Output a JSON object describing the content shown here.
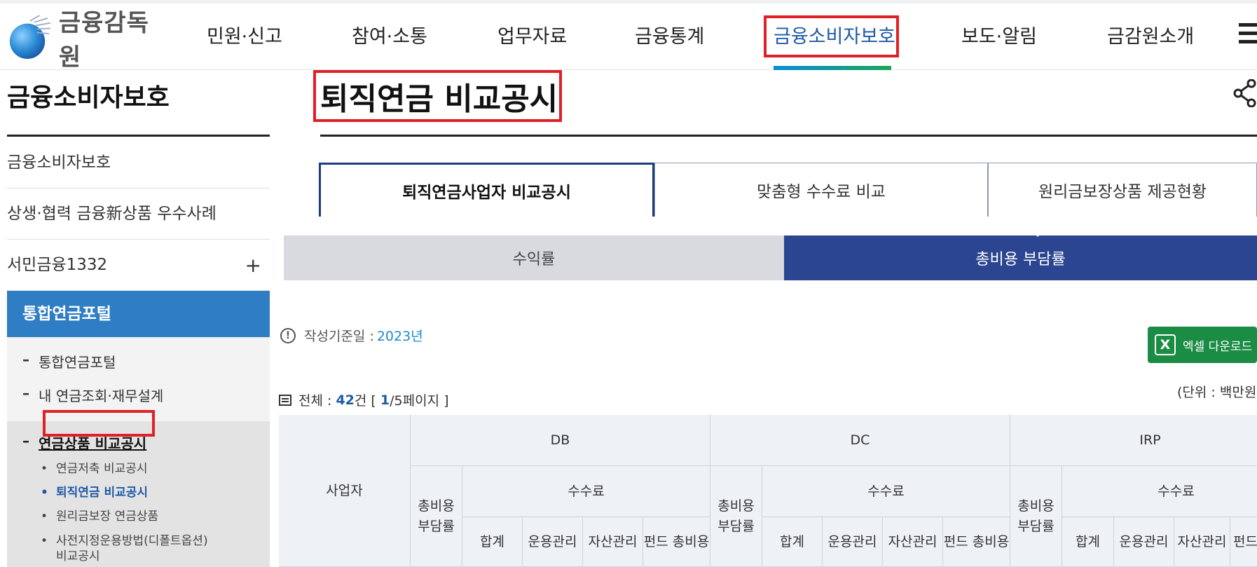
{
  "header": {
    "logo_text": "금융감독원",
    "nav": [
      "민원·신고",
      "참여·소통",
      "업무자료",
      "금융통계",
      "금융소비자보호",
      "보도·알림",
      "금감원소개"
    ],
    "active_nav": "금융소비자보호"
  },
  "sidebar": {
    "title": "금융소비자보호",
    "links": [
      "금융소비자보호",
      "상생·협력 금융新상품 우수사례",
      "서민금융1332"
    ],
    "expand_symbol": "+",
    "section": "통합연금포털",
    "sub_items": [
      "통합연금포털",
      "내 연금조회·재무설계"
    ],
    "current": "연금상품 비교공시",
    "bullets": [
      "연금저축 비교공시",
      "퇴직연금 비교공시",
      "원리금보장 연금상품",
      "사전지정운용방법(디폴트옵션)",
      "비교공시"
    ],
    "active_bullet": "퇴직연금 비교공시"
  },
  "main": {
    "title": "퇴직연금 비교공시",
    "tabs": [
      "퇴직연금사업자 비교공시",
      "맞춤형 수수료 비교",
      "원리금보장상품 제공현황"
    ],
    "subtabs": [
      "수익률",
      "총비용 부담률"
    ],
    "basis_label": "작성기준일 :",
    "basis_value": "2023년",
    "excel_label": "엑셀 다운로드",
    "total_label": "전체 :",
    "total_count": "42",
    "total_suffix": "건 [",
    "page_current": "1",
    "page_suffix": "/5페이지 ]",
    "unit": "(단위 : 백만원, %)"
  },
  "table": {
    "company_header": "사업자",
    "groups": [
      "DB",
      "DC",
      "IRP"
    ],
    "fee_header": "수수료",
    "ratio_line1": "총비용",
    "ratio_line2": "부담률",
    "fee_cols": [
      "합계",
      "운용관리",
      "자산관리",
      "펀드 총비용"
    ]
  },
  "colors": {
    "accent_blue": "#1f5aa6",
    "navy": "#2c4590",
    "red_highlight": "#e02027",
    "excel_green": "#1b8c44",
    "sidebar_blue": "#2f7dc4"
  }
}
